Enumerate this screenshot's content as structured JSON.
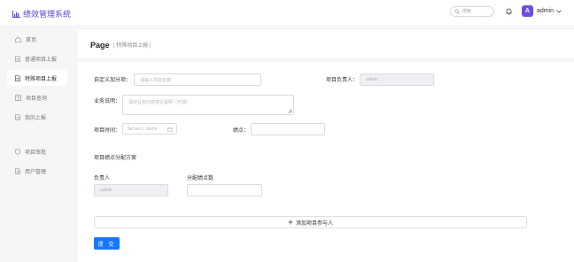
{
  "header": {
    "brand": "绩效管理系统",
    "search_placeholder": "搜索",
    "avatar_letter": "A",
    "username": "admin"
  },
  "sidebar": {
    "items": [
      {
        "label": "首页",
        "icon": "home-icon"
      },
      {
        "label": "普通项目上报",
        "icon": "file-icon"
      },
      {
        "label": "特殊项目上报",
        "icon": "file-icon",
        "active": true
      },
      {
        "label": "项目查询",
        "icon": "table-icon"
      },
      {
        "label": "我的上报",
        "icon": "file-icon"
      },
      {
        "label": "项目审批",
        "icon": "shield-icon"
      },
      {
        "label": "用户管理",
        "icon": "users-icon"
      }
    ]
  },
  "page": {
    "title": "Page",
    "subtitle": "| 特殊项目上报 |"
  },
  "form": {
    "custom_label": "自定义加分项：",
    "custom_placeholder": "请输入项目名称",
    "owner_label": "项目负责人：",
    "owner_value": "admin",
    "desc_label": "业务说明：",
    "desc_placeholder": "请对业务内容进行说明（可选）",
    "time_label": "项目时间：",
    "time_placeholder": "Select date",
    "points_label": "绩点：",
    "points_value": "",
    "plan_title": "项目绩点分配方案",
    "col_person": "负责人",
    "col_points": "分配绩点数",
    "row_person": "admin",
    "row_points": "",
    "add_label": "添加项目参与人",
    "submit_label": "提 交"
  },
  "colors": {
    "brand": "#5b3fd6",
    "avatar": "#6c4ee6",
    "primary": "#1677ff"
  }
}
